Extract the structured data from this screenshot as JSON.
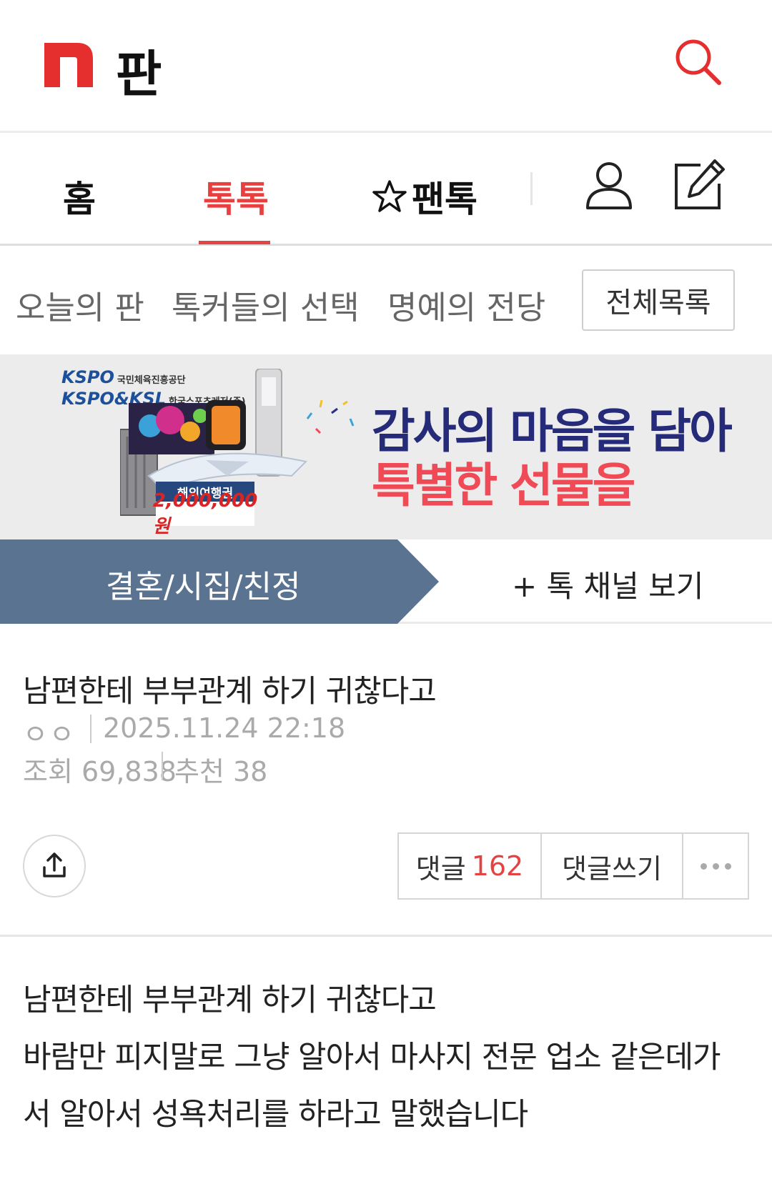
{
  "header": {
    "logo_text": "n",
    "section_title": "판",
    "brand_color": "#e52f2f",
    "search_icon": "search-icon"
  },
  "main_tabs": [
    {
      "label": "홈",
      "active": false
    },
    {
      "label": "톡톡",
      "active": true
    },
    {
      "label": "팬톡",
      "active": false,
      "icon": "star-outline-icon"
    }
  ],
  "header_actions": {
    "user_icon": "user-icon",
    "write_icon": "edit-icon"
  },
  "sub_nav": {
    "items": [
      "오늘의 판",
      "톡커들의 선택",
      "명예의 전당"
    ],
    "full_list_label": "전체목록"
  },
  "banner": {
    "org_1": "KSPO",
    "org_1_sub": "국민체육진흥공단",
    "org_2": "KSPO&KSL",
    "org_2_sub": "한국스포츠레저(주)",
    "voucher_label": "해외여행권",
    "voucher_amount": "2,000,000원",
    "headline": "감사의 마음을 담아",
    "subline": "특별한 선물을"
  },
  "channel": {
    "name": "결혼/시집/친정",
    "more_label": "+ 톡 채널 보기",
    "bar_color": "#5a7391"
  },
  "post": {
    "title": "남편한테 부부관계 하기 귀찮다고",
    "author": "ㅇㅇ",
    "date": "2025.11.24 22:18",
    "views": "조회 69,838",
    "recommend": "추천 38",
    "comment_label": "댓글",
    "comment_count": "162",
    "write_comment_label": "댓글쓰기",
    "more_icon": "more-horizontal-icon",
    "share_icon": "share-icon"
  },
  "post_body": [
    "남편한테 부부관계 하기 귀찮다고",
    "바람만 피지말로 그냥 알아서 마사지 전문 업소 같은데가",
    "서 알아서 성욕처리를 하라고 말했습니다"
  ]
}
